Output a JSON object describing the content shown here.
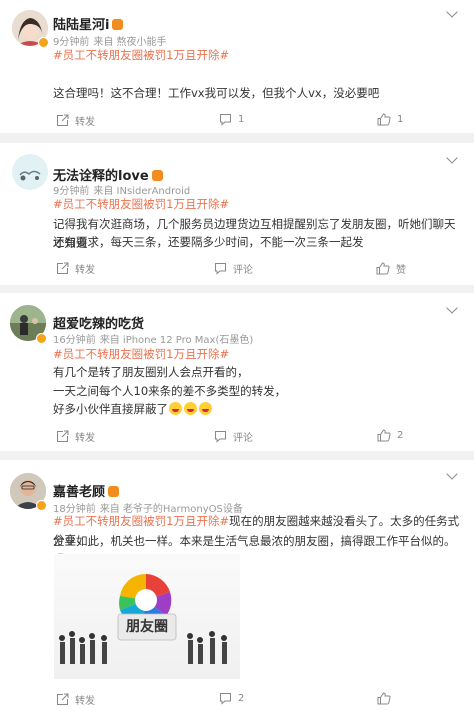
{
  "posts": [
    {
      "user": "陆陆星河i",
      "time": "9分钟前",
      "source": "来自 熬夜小能手",
      "tag": "#员工不转朋友圈被罚1万且开除#",
      "text": "这合理吗！这不合理！工作vx我可以发，但我个人vx，没必要吧",
      "repost": "转发",
      "comment": "1",
      "like": "1"
    },
    {
      "user": "无法诠释的love",
      "time": "9分钟前",
      "source": "来自 INsiderAndroid",
      "tag": "#员工不转朋友圈被罚1万且开除#",
      "text_line1": "记得我有次逛商场，几个服务员边理货边互相提醒别忘了发朋友圈，听她们聊天才知道",
      "text_line2": "还有要求，每天三条，还要隔多少时间，不能一次三条一起发",
      "repost": "转发",
      "comment": "评论",
      "like": "赞"
    },
    {
      "user": "超爱吃辣的吃货",
      "time": "16分钟前",
      "source": "来自 iPhone 12 Pro Max(石墨色)",
      "tag": "#员工不转朋友圈被罚1万且开除#",
      "line1": "有几个是转了朋友圈别人会点开看的，",
      "line2": "一天之间每个人10来条的差不多类型的转发，",
      "line3": "好多小伙伴直接屏蔽了",
      "repost": "转发",
      "comment": "评论",
      "like": "2"
    },
    {
      "user": "嘉善老顾",
      "time": "18分钟前",
      "source": "来自 老爷子的HarmonyOS设备",
      "tag": "#员工不转朋友圈被罚1万且开除#",
      "text_after_tag": "现在的朋友圈越来越没看头了。太多的任务式分享，",
      "text_line2": "企业如此，机关也一样。本来是生活气息最浓的朋友圈，搞得跟工作平台似的。",
      "image_caption": "朋友圈",
      "repost": "转发",
      "comment": "2",
      "like": ""
    }
  ],
  "colors": {
    "topic": "#eb7350",
    "vip": "#f38c1f"
  }
}
